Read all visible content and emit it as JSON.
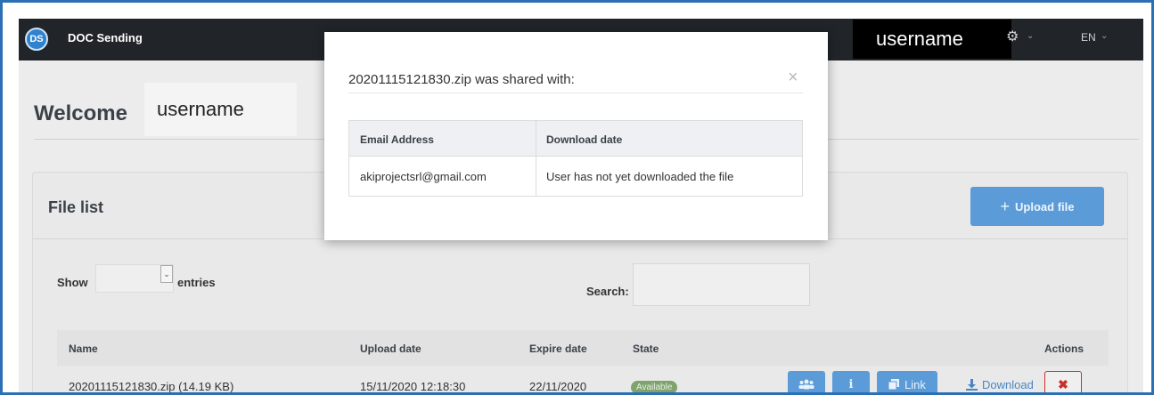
{
  "app": {
    "logo_text": "DS",
    "title": "DOC Sending",
    "username": "username",
    "language": "EN"
  },
  "welcome": {
    "label": "Welcome",
    "username": "username"
  },
  "file_list": {
    "title": "File list",
    "upload_label": "Upload file",
    "show_label": "Show",
    "entries_label": "entries",
    "search_label": "Search:",
    "columns": {
      "name": "Name",
      "upload_date": "Upload date",
      "expire_date": "Expire date",
      "state": "State",
      "actions": "Actions"
    },
    "rows": [
      {
        "name": "20201115121830.zip (14.19 KB)",
        "upload_date": "15/11/2020 12:18:30",
        "expire_date": "22/11/2020",
        "state": "Available",
        "link_label": "Link",
        "download_label": "Download"
      }
    ]
  },
  "modal": {
    "title": "20201115121830.zip was shared with:",
    "columns": {
      "email": "Email Address",
      "download_date": "Download date"
    },
    "rows": [
      {
        "email": "akiprojectsrl@gmail.com",
        "download_date": "User has not yet downloaded the file"
      }
    ]
  },
  "colors": {
    "topbar": "#212529",
    "accent": "#5a9bd8",
    "danger": "#c9302c",
    "available": "#7fa36c"
  }
}
